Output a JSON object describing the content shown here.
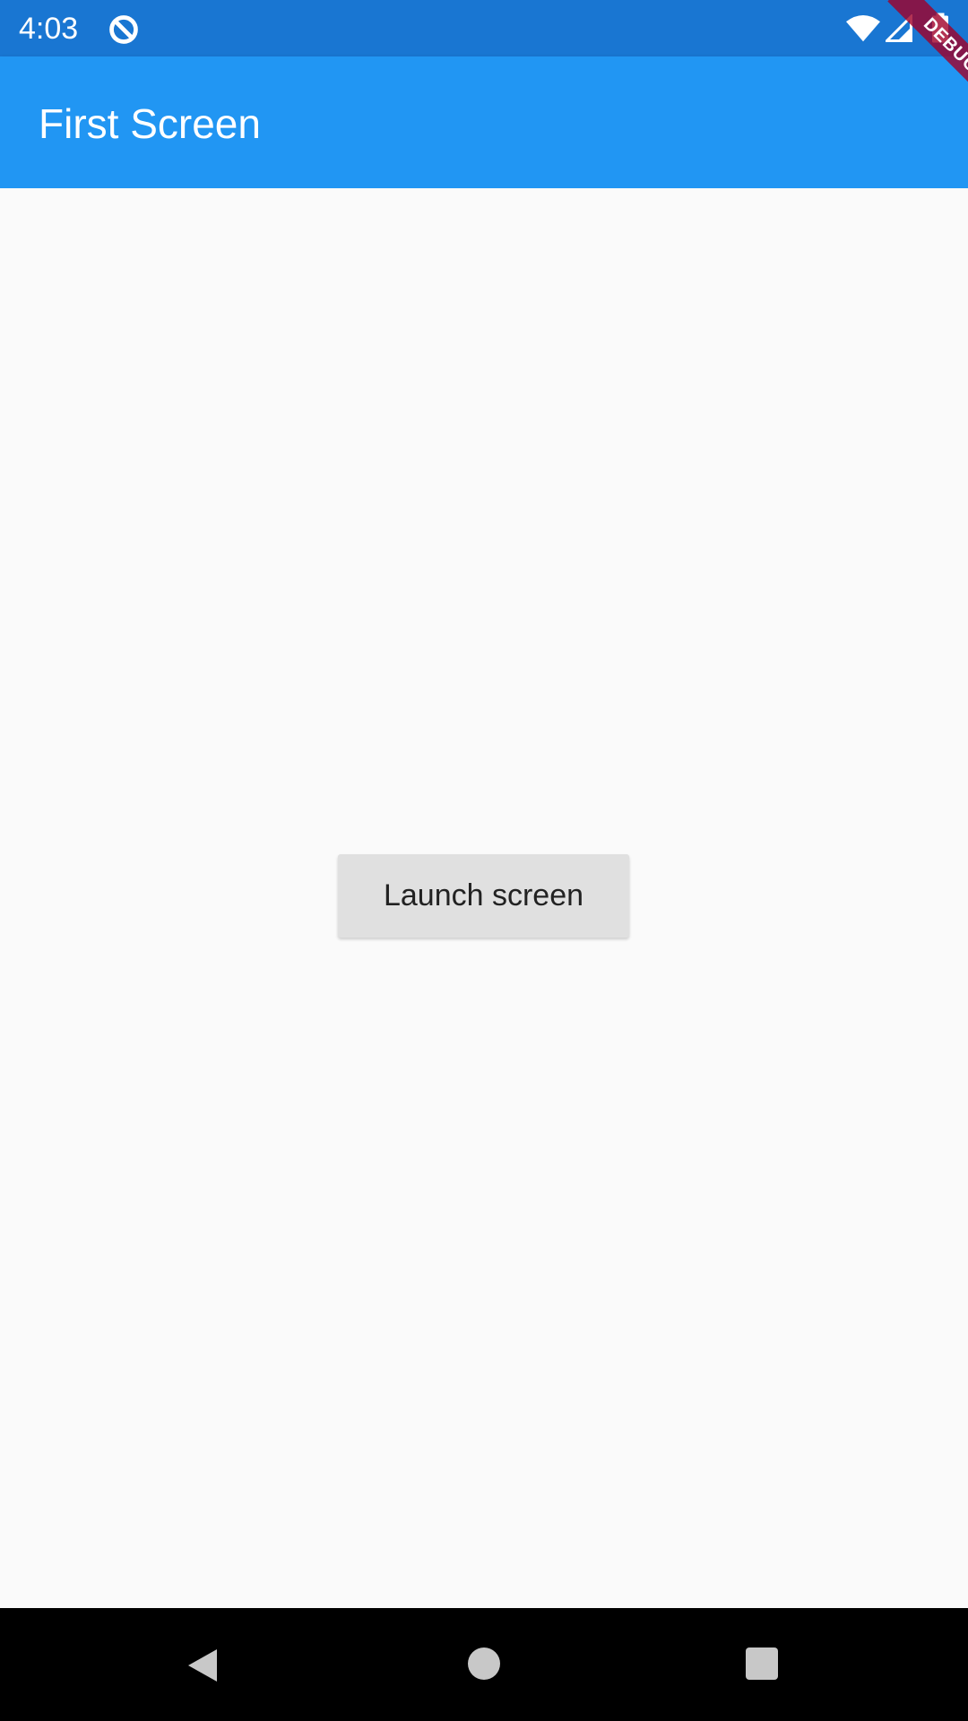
{
  "status_bar": {
    "time": "4:03",
    "icons": [
      "sync-icon",
      "wifi-icon",
      "signal-icon",
      "battery-icon"
    ]
  },
  "debug_banner": {
    "label": "DEBUG"
  },
  "app_bar": {
    "title": "First Screen",
    "color": "#2196f3"
  },
  "main": {
    "launch_button_label": "Launch screen"
  },
  "navigation_bar": {
    "icons": [
      "back-icon",
      "home-icon",
      "recents-icon"
    ]
  },
  "colors": {
    "status_bar": "#1976d2",
    "app_bar": "#2196f3",
    "background": "#fafafa",
    "button": "#e0e0e0",
    "nav_bar": "#000000"
  }
}
